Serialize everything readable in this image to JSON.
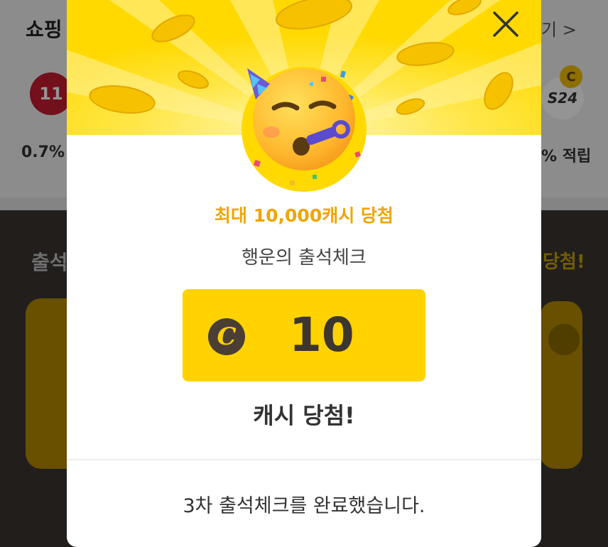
{
  "background": {
    "section_title": "쇼핑",
    "more_link": "기 >",
    "left_logo_text": "11",
    "right_logo_text": "S24",
    "coin_badge": "C",
    "left_rate": "0.7%",
    "right_rate": "% 적립",
    "dark_left_text": "출석",
    "dark_right_text": "당첨!"
  },
  "modal": {
    "promo_text": "최대 10,000캐시 당첨",
    "subtitle": "행운의 출석체크",
    "coin_symbol": "C",
    "amount": "10",
    "win_text": "캐시 당첨!",
    "footer_message": "3차 출석체크를 완료했습니다."
  },
  "colors": {
    "header_yellow": "#ffd900",
    "box_yellow": "#ffd200",
    "promo_orange": "#f0a500",
    "coin_brown": "#4a3e35"
  },
  "icons": {
    "close": "close-icon",
    "emoji": "partying-face-icon",
    "coin": "cash-coin-icon"
  }
}
